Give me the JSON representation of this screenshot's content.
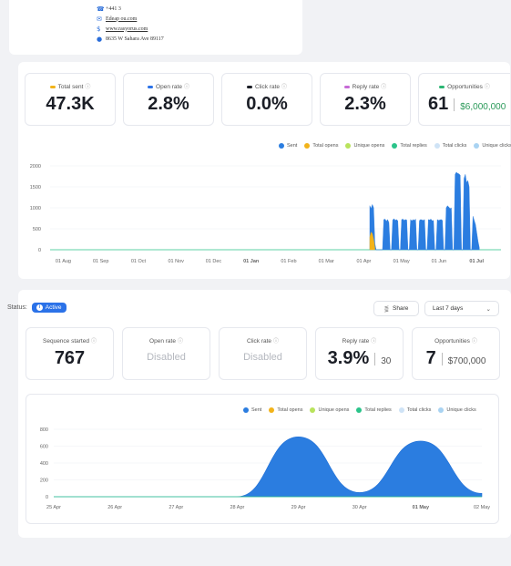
{
  "contact": {
    "phone": "+441          3",
    "email": "Edeap               ou.com",
    "website": "www.rasyorus.com",
    "address": "8635 W Sahara Ave 89117"
  },
  "overview": {
    "cards": [
      {
        "label": "Total sent",
        "value": "47.3K",
        "dot_color": "#f2b31a"
      },
      {
        "label": "Open rate",
        "value": "2.8%",
        "dot_color": "#2b72e8"
      },
      {
        "label": "Click rate",
        "value": "0.0%",
        "dot_color": "#1b1e26"
      },
      {
        "label": "Reply rate",
        "value": "2.3%",
        "dot_color": "#c66ad6"
      },
      {
        "label": "Opportunities",
        "value": "61",
        "sub": "$6,000,000",
        "dot_color": "#2bb673"
      }
    ],
    "legend": [
      {
        "label": "Sent",
        "color": "#2b7de0"
      },
      {
        "label": "Total opens",
        "color": "#f2b31a"
      },
      {
        "label": "Unique opens",
        "color": "#b9e35c"
      },
      {
        "label": "Total replies",
        "color": "#2bc48a"
      },
      {
        "label": "Total clicks",
        "color": "#cfe3f6"
      },
      {
        "label": "Unique clicks",
        "color": "#a9d3f2"
      }
    ]
  },
  "status": {
    "label": "Status:",
    "badge": "Active",
    "share_label": "Share",
    "range_label": "Last 7 days"
  },
  "sequence": {
    "cards": [
      {
        "label": "Sequence started",
        "value": "767"
      },
      {
        "label": "Open rate",
        "value": "Disabled"
      },
      {
        "label": "Click rate",
        "value": "Disabled"
      },
      {
        "label": "Reply rate",
        "value": "3.9%",
        "sub": "30"
      },
      {
        "label": "Opportunities",
        "value": "7",
        "sub": "$700,000"
      }
    ],
    "legend": [
      {
        "label": "Sent",
        "color": "#2b7de0"
      },
      {
        "label": "Total opens",
        "color": "#f2b31a"
      },
      {
        "label": "Unique opens",
        "color": "#b9e35c"
      },
      {
        "label": "Total replies",
        "color": "#2bc48a"
      },
      {
        "label": "Total clicks",
        "color": "#cfe3f6"
      },
      {
        "label": "Unique clicks",
        "color": "#a9d3f2"
      }
    ]
  },
  "chart_data": [
    {
      "type": "area",
      "x": [
        "01 Aug",
        "01 Sep",
        "01 Oct",
        "01 Nov",
        "01 Dec",
        "01 Jan",
        "01 Feb",
        "01 Mar",
        "01 Apr",
        "01 May",
        "01 Jun",
        "01 Jul"
      ],
      "y_ticks": [
        0,
        500,
        1000,
        1500,
        2000
      ],
      "ylim": [
        0,
        2000
      ],
      "series": [
        {
          "name": "Sent",
          "color": "#2b7de0",
          "start": "2024-04-08",
          "values": [
            1050,
            980,
            1080,
            1000,
            150,
            0,
            0,
            0,
            0,
            0,
            0,
            720,
            730,
            680,
            720,
            650,
            0,
            0,
            710,
            740,
            700,
            720,
            690,
            0,
            0,
            720,
            730,
            700,
            720,
            710,
            0,
            0,
            720,
            690,
            720,
            700,
            730,
            0,
            0,
            700,
            720,
            710,
            700,
            720,
            0,
            0,
            720,
            710,
            730,
            690,
            700,
            0,
            0,
            720,
            700,
            710,
            720,
            700,
            0,
            0,
            1000,
            1050,
            1020,
            980,
            1000,
            0,
            0,
            1800,
            1850,
            1820,
            1810,
            1780,
            0,
            0,
            1700,
            1800,
            1600,
            1650,
            1500,
            0,
            0,
            800,
            700,
            600,
            400,
            200,
            50
          ]
        },
        {
          "name": "Total opens",
          "color": "#f2b31a",
          "start": "2024-04-08",
          "values": [
            300,
            420,
            380,
            250,
            50
          ]
        }
      ]
    },
    {
      "type": "area",
      "x": [
        "25 Apr",
        "26 Apr",
        "27 Apr",
        "28 Apr",
        "29 Apr",
        "30 Apr",
        "01 May",
        "02 May"
      ],
      "y_ticks": [
        0,
        200,
        400,
        600,
        800
      ],
      "ylim": [
        0,
        800
      ],
      "series": [
        {
          "name": "Sent",
          "color": "#2b7de0",
          "values": [
            0,
            0,
            0,
            0,
            710,
            50,
            660,
            40
          ]
        },
        {
          "name": "Total opens",
          "color": "#f2b31a",
          "values": [
            0,
            0,
            0,
            0,
            0,
            0,
            0,
            0
          ]
        }
      ]
    }
  ]
}
